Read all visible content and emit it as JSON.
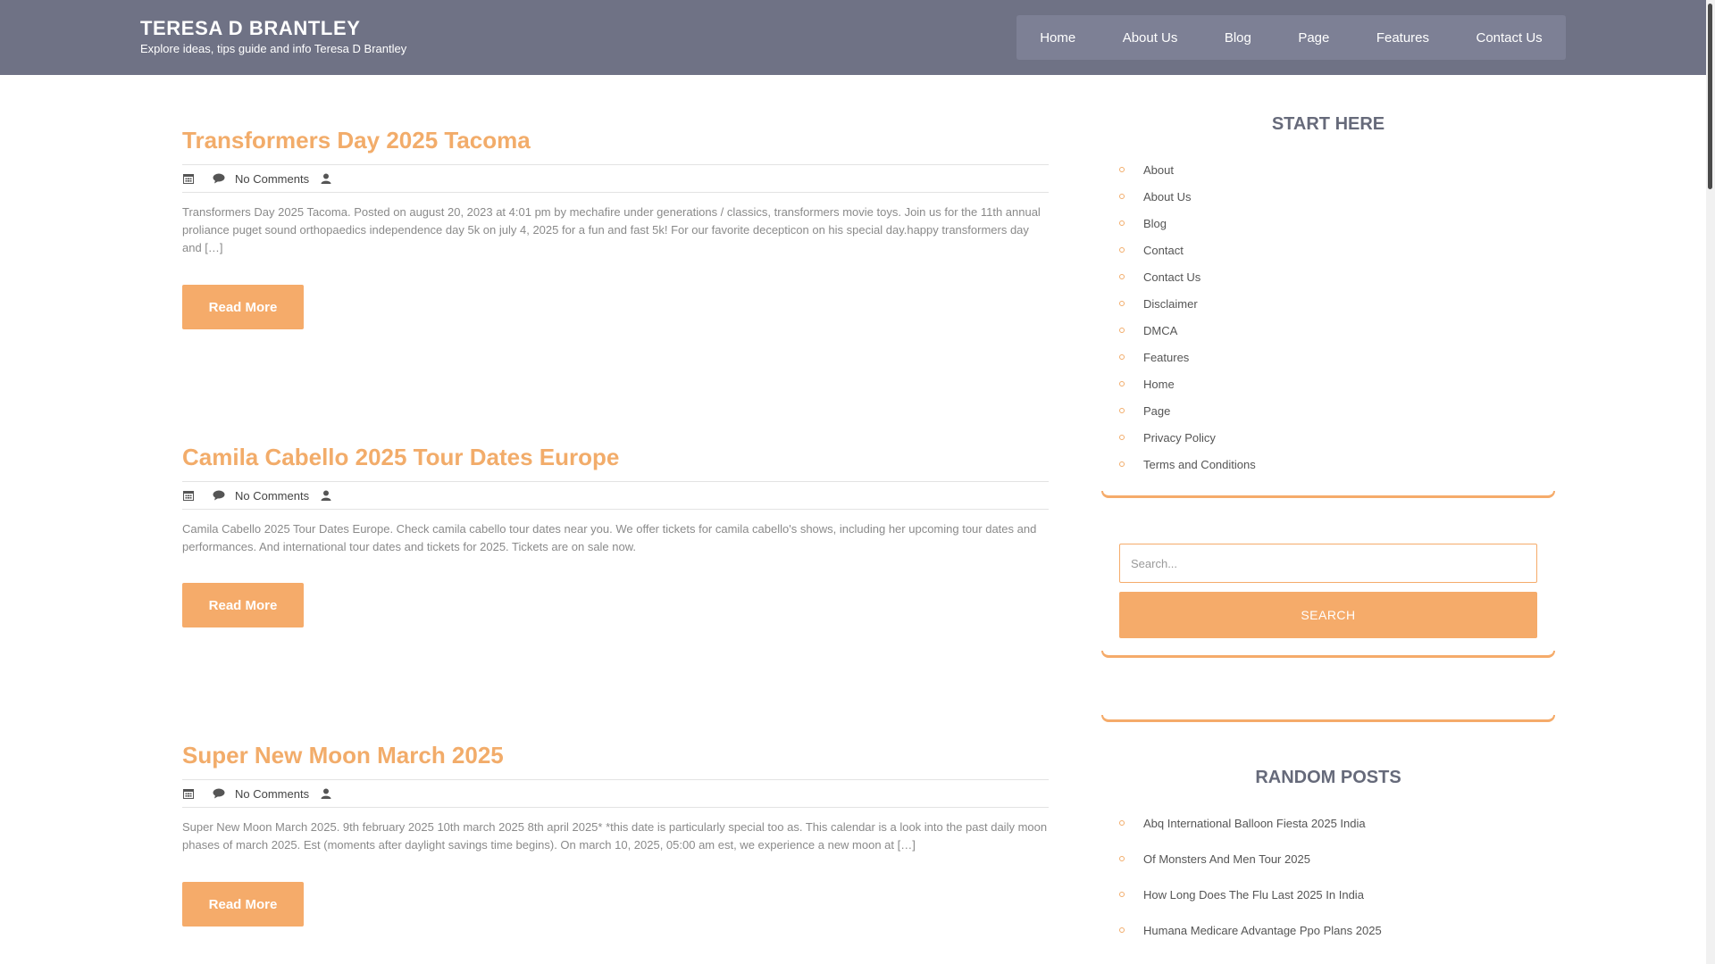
{
  "site": {
    "title": "TERESA D BRANTLEY",
    "tagline": "Explore ideas, tips guide and info Teresa D Brantley"
  },
  "nav": {
    "items": [
      "Home",
      "About Us",
      "Blog",
      "Page",
      "Features",
      "Contact Us"
    ]
  },
  "posts": [
    {
      "title": "Transformers Day 2025 Tacoma",
      "comments": "No Comments",
      "excerpt": "Transformers Day 2025 Tacoma. Posted on august 20, 2023 at 4:01 pm by mechafire under generations / classics, transformers movie toys. Join us for the 11th annual proliance puget sound orthopaedics independence day 5k on july 4, 2025 for a fun and fast 5k! For our favorite decepticon on his special day.happy transformers day and […]",
      "read_more": "Read More"
    },
    {
      "title": "Camila Cabello 2025 Tour Dates Europe",
      "comments": "No Comments",
      "excerpt": "Camila Cabello 2025 Tour Dates Europe. Check camila cabello tour dates near you. We offer tickets for camila cabello's shows, including her upcoming tour dates and performances. And international tour dates and tickets for 2025. Tickets are on sale now.",
      "read_more": "Read More"
    },
    {
      "title": "Super New Moon March 2025",
      "comments": "No Comments",
      "excerpt": "Super New Moon March 2025. 9th february 2025 10th march 2025 8th april 2025* *this date is particularly special too as. This calendar is a look into the past daily moon phases of march 2025. Est (moments after daylight savings time begins). On march 10, 2025, 05:00 am est, we experience a new moon at […]",
      "read_more": "Read More"
    }
  ],
  "sidebar": {
    "start_here": {
      "title": "START HERE",
      "items": [
        "About",
        "About Us",
        "Blog",
        "Contact",
        "Contact Us",
        "Disclaimer",
        "DMCA",
        "Features",
        "Home",
        "Page",
        "Privacy Policy",
        "Terms and Conditions"
      ]
    },
    "search": {
      "placeholder": "Search...",
      "button_label": "SEARCH"
    },
    "random_posts": {
      "title": "RANDOM POSTS",
      "items": [
        "Abq International Balloon Fiesta 2025 India",
        "Of Monsters And Men Tour 2025",
        "How Long Does The Flu Last 2025 In India",
        "Humana Medicare Advantage Ppo Plans 2025"
      ]
    }
  },
  "icons": {
    "date": "calendar-icon",
    "comments": "comment-icon",
    "author": "user-icon"
  },
  "colors": {
    "header_bg": "#6f7285",
    "nav_bg": "#7d8095",
    "accent": "#f5ab6a",
    "heading": "#666a7a"
  }
}
